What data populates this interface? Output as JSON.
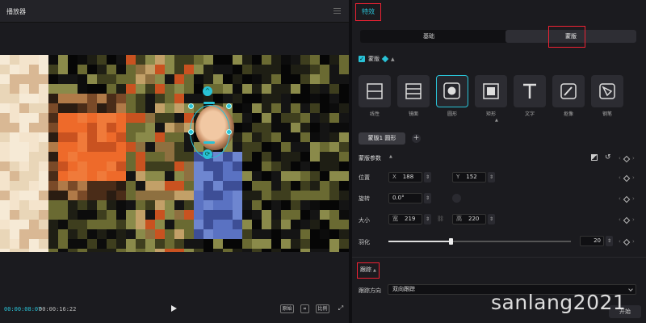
{
  "player": {
    "title": "播放器",
    "time_current": "00:00:08:07",
    "time_total": "00:00:16:22",
    "foot_btn_1": "原始",
    "foot_btn_2": "比例"
  },
  "panel": {
    "tab_effect": "特效",
    "seg_basic": "基础",
    "seg_mask": "蒙版",
    "mask_enabled_label": "蒙版",
    "shapes": [
      {
        "label": "线性",
        "icon": "linear-icon"
      },
      {
        "label": "镜面",
        "icon": "mirror-icon"
      },
      {
        "label": "圆形",
        "icon": "circle-icon"
      },
      {
        "label": "矩形",
        "icon": "rectangle-icon"
      },
      {
        "label": "文字",
        "icon": "text-icon"
      },
      {
        "label": "抠像",
        "icon": "brush-icon"
      },
      {
        "label": "钢笔",
        "icon": "pen-icon"
      }
    ],
    "mask_tag": "蒙版1 圆形",
    "params_title": "蒙版参数",
    "position": {
      "label": "位置",
      "x_key": "X",
      "x": "188",
      "y_key": "Y",
      "y": "152"
    },
    "rotation": {
      "label": "旋转",
      "value": "0.0°"
    },
    "size": {
      "label": "大小",
      "w_key": "宽",
      "w": "219",
      "h_key": "高",
      "h": "220"
    },
    "feather": {
      "label": "羽化",
      "value": "20",
      "fraction": 0.2
    },
    "track_title": "跟踪",
    "track_direction_label": "跟踪方向",
    "track_direction_value": "双向跟踪",
    "track_button": "开始"
  },
  "watermark": "sanlang2021",
  "colors": {
    "accent": "#29c2d6",
    "highlight": "#ee2233"
  }
}
